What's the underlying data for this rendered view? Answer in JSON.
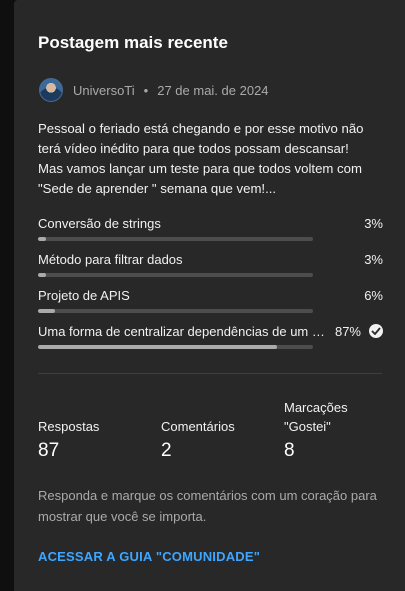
{
  "card": {
    "title": "Postagem mais recente"
  },
  "post": {
    "author": "UniversoTi",
    "separator": "•",
    "date": "27 de mai. de 2024",
    "text": "Pessoal o  feriado está chegando e por esse motivo não terá vídeo inédito para que todos possam descansar! Mas vamos lançar um teste para que todos voltem com \"Sede de aprender \" semana que vem!..."
  },
  "poll": {
    "options": [
      {
        "label": "Conversão de strings",
        "percent_text": "3%",
        "percent": 3
      },
      {
        "label": "Método para filtrar dados",
        "percent_text": "3%",
        "percent": 3
      },
      {
        "label": "Projeto de APIS",
        "percent_text": "6%",
        "percent": 6
      },
      {
        "label": "Uma forma de centralizar dependências de um p...",
        "percent_text": "87%",
        "percent": 87,
        "selected": true
      }
    ]
  },
  "stats": {
    "replies_label": "Respostas",
    "replies_value": "87",
    "comments_label": "Comentários",
    "comments_value": "2",
    "likes_label": "Marcações \"Gostei\"",
    "likes_value": "8"
  },
  "hint": "Responda e marque os comentários com um coração para mostrar que você se importa.",
  "link": "ACESSAR A GUIA \"COMUNIDADE\"",
  "icons": {
    "avatar": "channel-avatar",
    "selected": "check-circle-icon"
  },
  "colors": {
    "background": "#0f0f0f",
    "card": "#282828",
    "link": "#3ea6ff",
    "track": "#4d4d4d",
    "fill": "#aaaaaa"
  }
}
